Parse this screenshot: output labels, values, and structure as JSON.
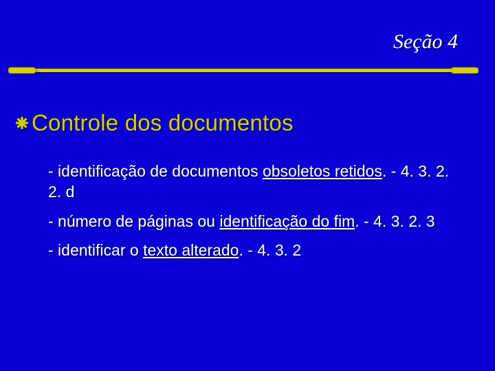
{
  "header": {
    "section_label": "Seção 4"
  },
  "title": {
    "bullet_icon": "flower-bullet",
    "text": "Controle dos documentos"
  },
  "body": {
    "items": [
      {
        "pre": "- identificação de documentos ",
        "u": "obsoletos retidos",
        "post": ". - 4. 3. 2. 2. d"
      },
      {
        "pre": "- número de páginas ou ",
        "u": "identificação do fim",
        "post": ". - 4. 3. 2. 3"
      },
      {
        "pre": "- identificar o ",
        "u": "texto alterado",
        "post": ". - 4. 3. 2"
      }
    ]
  }
}
